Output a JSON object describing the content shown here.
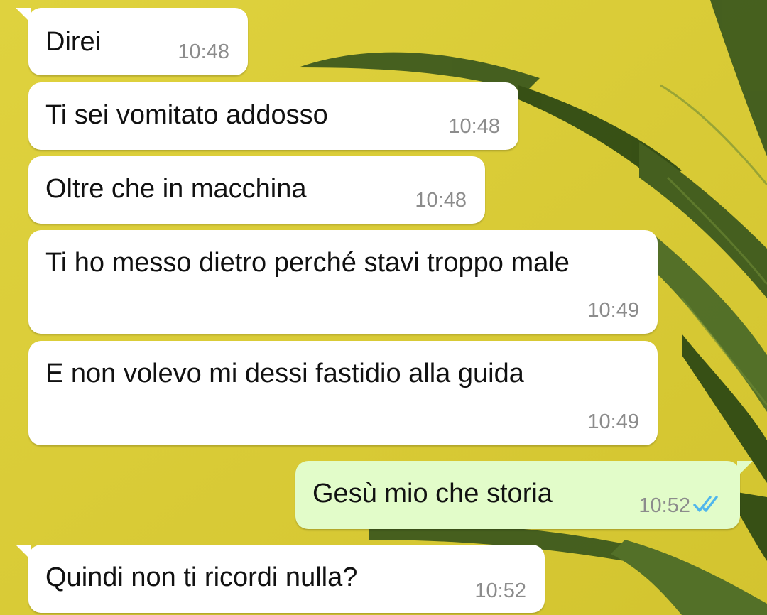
{
  "chat": {
    "messages": [
      {
        "text": "Direi",
        "time": "10:48",
        "direction": "incoming"
      },
      {
        "text": "Ti sei vomitato addosso",
        "time": "10:48",
        "direction": "incoming"
      },
      {
        "text": "Oltre che in macchina",
        "time": "10:48",
        "direction": "incoming"
      },
      {
        "text": "Ti ho messo dietro perché stavi troppo male",
        "time": "10:49",
        "direction": "incoming"
      },
      {
        "text": "E non volevo mi dessi fastidio alla guida",
        "time": "10:49",
        "direction": "incoming"
      },
      {
        "text": "Gesù mio che storia",
        "time": "10:52",
        "direction": "outgoing",
        "status": "read",
        "status_icon": "double-check-icon"
      },
      {
        "text": "Quindi non ti ricordi nulla?",
        "time": "10:52",
        "direction": "incoming"
      }
    ]
  },
  "colors": {
    "wallpaper": "#dccf3a",
    "incoming_bubble": "#ffffff",
    "outgoing_bubble": "#e2fcc9",
    "timestamp": "#8c8c8c",
    "read_tick": "#4fb6ec"
  }
}
